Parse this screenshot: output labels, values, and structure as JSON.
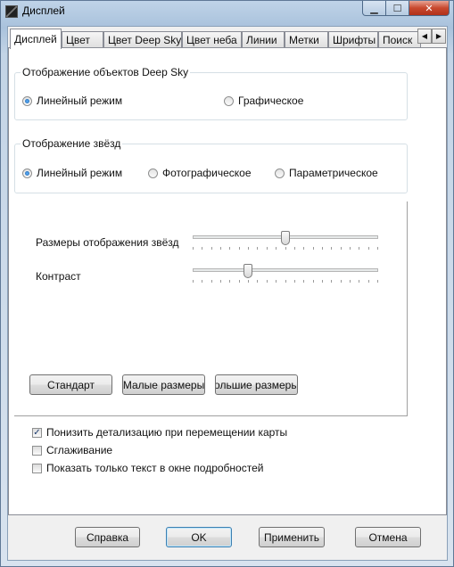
{
  "window": {
    "title": "Дисплей"
  },
  "tabs": [
    "Дисплей",
    "Цвет",
    "Цвет Deep Sky",
    "Цвет неба",
    "Линии",
    "Метки",
    "Шрифты",
    "Поиск"
  ],
  "deep_sky_group": {
    "title": "Отображение объектов Deep Sky",
    "options": [
      "Линейный режим",
      "Графическое"
    ],
    "selected": 0
  },
  "stars_group": {
    "title": "Отображение звёзд",
    "options": [
      "Линейный режим",
      "Фотографическое",
      "Параметрическое"
    ],
    "selected": 0
  },
  "sliders": {
    "star_size": {
      "label": "Размеры отображения звёзд",
      "value_fraction": 0.5
    },
    "contrast": {
      "label": "Контраст",
      "value_fraction": 0.3
    }
  },
  "size_buttons": [
    "Стандарт",
    "Малые размеры",
    "ольшие размеры"
  ],
  "checkboxes": [
    {
      "label": "Понизить детализацию при перемещении карты",
      "checked": true
    },
    {
      "label": "Сглаживание",
      "checked": false
    },
    {
      "label": "Показать только текст в окне подробностей",
      "checked": false
    }
  ],
  "footer": {
    "help": "Справка",
    "ok": "OK",
    "apply": "Применить",
    "cancel": "Отмена"
  }
}
